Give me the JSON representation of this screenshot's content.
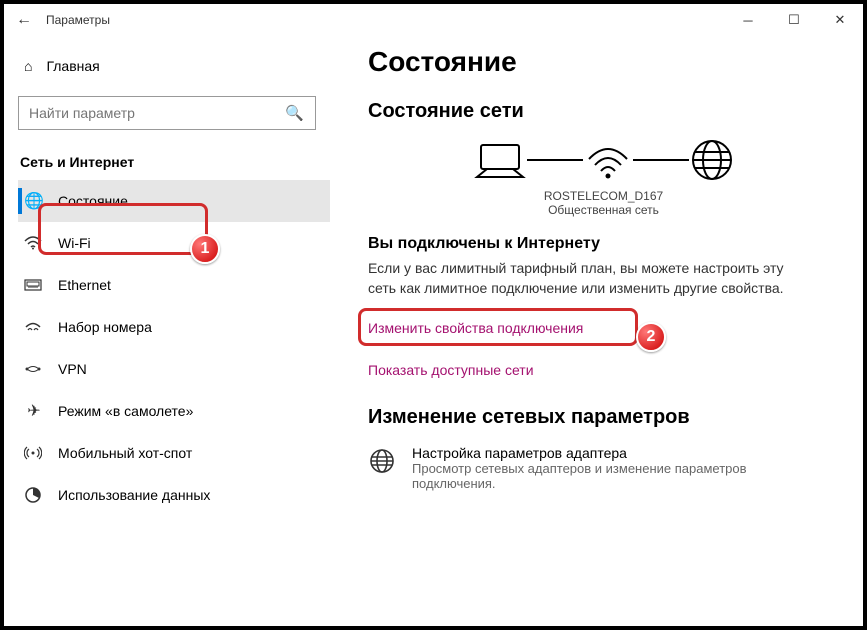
{
  "titlebar": {
    "title": "Параметры"
  },
  "sidebar": {
    "home": "Главная",
    "search_placeholder": "Найти параметр",
    "category": "Сеть и Интернет",
    "items": [
      {
        "label": "Состояние"
      },
      {
        "label": "Wi-Fi"
      },
      {
        "label": "Ethernet"
      },
      {
        "label": "Набор номера"
      },
      {
        "label": "VPN"
      },
      {
        "label": "Режим «в самолете»"
      },
      {
        "label": "Мобильный хот-спот"
      },
      {
        "label": "Использование данных"
      }
    ]
  },
  "content": {
    "heading": "Состояние",
    "subheading": "Состояние сети",
    "wifi_name": "ROSTELECOM_D167",
    "wifi_type": "Общественная сеть",
    "connected_title": "Вы подключены к Интернету",
    "connected_desc": "Если у вас лимитный тарифный план, вы можете настроить эту сеть как лимитное подключение или изменить другие свойства.",
    "link_change_props": "Изменить свойства подключения",
    "link_show_networks": "Показать доступные сети",
    "change_params_heading": "Изменение сетевых параметров",
    "adapter_title": "Настройка параметров адаптера",
    "adapter_desc": "Просмотр сетевых адаптеров и изменение параметров подключения."
  },
  "badges": {
    "b1": "1",
    "b2": "2"
  }
}
